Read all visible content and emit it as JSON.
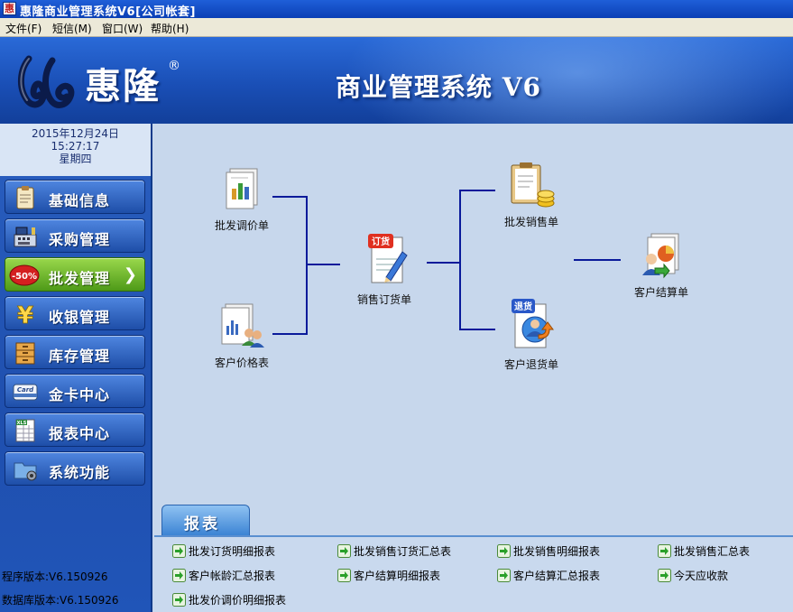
{
  "window": {
    "app_icon_text": "惠",
    "title": "惠隆商业管理系统V6[公司帐套]"
  },
  "menu": {
    "items": [
      "文件(F)",
      "短信(M)",
      "窗口(W)",
      "帮助(H)"
    ]
  },
  "banner": {
    "brand": "惠隆",
    "registered_mark": "®",
    "system_title": "商业管理系统 V6"
  },
  "sidebar": {
    "date": "2015年12月24日",
    "time": "15:27:17",
    "weekday": "星期四",
    "nav": [
      {
        "label": "基础信息",
        "icon": "clipboard-icon"
      },
      {
        "label": "采购管理",
        "icon": "cash-register-icon"
      },
      {
        "label": "批发管理",
        "icon": "discount-badge-icon",
        "badge": "-50%",
        "active": true
      },
      {
        "label": "收银管理",
        "icon": "yen-icon"
      },
      {
        "label": "库存管理",
        "icon": "cabinet-icon"
      },
      {
        "label": "金卡中心",
        "icon": "card-icon",
        "icon_text": "Card"
      },
      {
        "label": "报表中心",
        "icon": "spreadsheet-icon",
        "icon_text": "XLS"
      },
      {
        "label": "系统功能",
        "icon": "system-folder-icon"
      }
    ],
    "program_version": "程序版本:V6.150926",
    "database_version": "数据库版本:V6.150926"
  },
  "flow": {
    "nodes": {
      "wholesale_price_adjust": "批发调价单",
      "customer_price_list": "客户价格表",
      "sales_order": "销售订货单",
      "sales_order_stamp": "订货",
      "wholesale_sales": "批发销售单",
      "customer_return": "客户退货单",
      "customer_return_stamp": "退货",
      "customer_settlement": "客户结算单"
    }
  },
  "reports": {
    "tab_label": "报表",
    "links": [
      "批发订货明细报表",
      "批发销售订货汇总表",
      "批发销售明细报表",
      "批发销售汇总表",
      "客户帐龄汇总报表",
      "客户结算明细报表",
      "客户结算汇总报表",
      "今天应收款",
      "批发价调价明细报表"
    ]
  },
  "colors": {
    "banner_blue": "#1a4fb6",
    "sidebar_blue": "#1f4fae",
    "active_green": "#4e9a18",
    "workspace_bg": "#c7d7ec",
    "connector_line": "#0a1a9a",
    "report_arrow": "#2aa02a"
  }
}
